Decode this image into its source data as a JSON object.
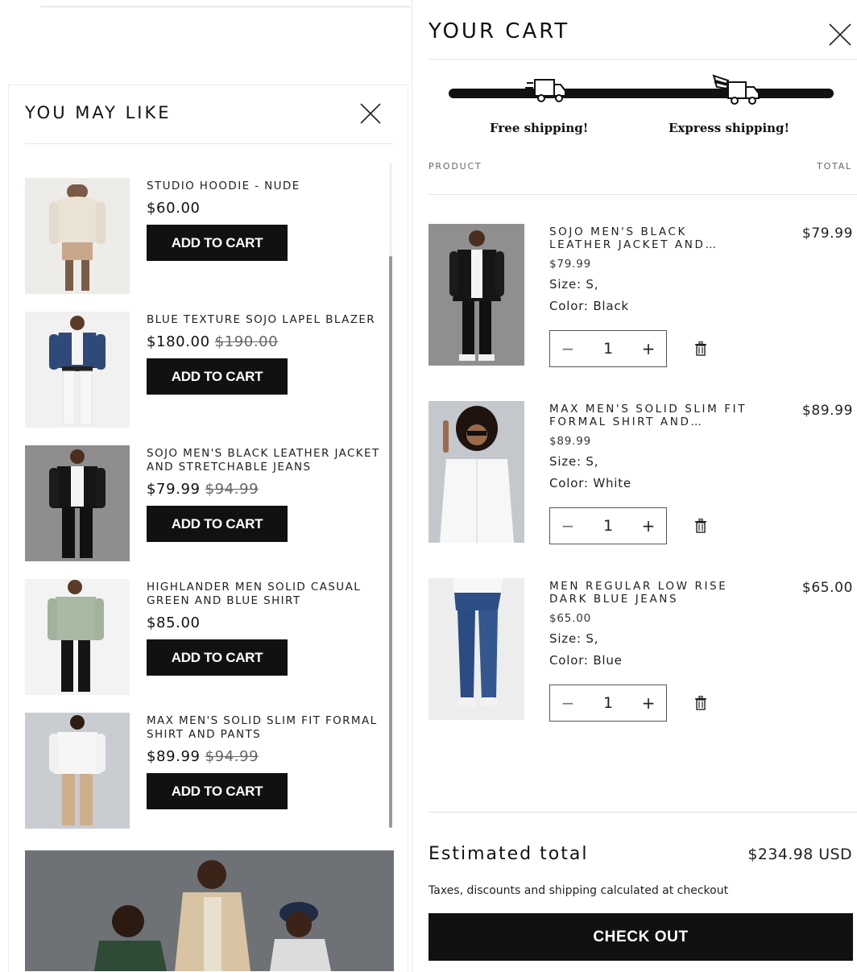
{
  "you_may_like": {
    "title": "YOU MAY LIKE",
    "close_icon": "close-icon",
    "items": [
      {
        "name": "STUDIO HOODIE - NUDE",
        "price": "$60.00",
        "compare_price": "",
        "button": "ADD TO CART",
        "image": "model-in-nude-hoodie"
      },
      {
        "name": "BLUE TEXTURE SOJO LAPEL BLAZER",
        "price": "$180.00",
        "compare_price": "$190.00",
        "button": "ADD TO CART",
        "image": "model-in-blue-blazer"
      },
      {
        "name": "SOJO MEN'S BLACK LEATHER JACKET AND STRETCHABLE JEANS",
        "price": "$79.99",
        "compare_price": "$94.99",
        "button": "ADD TO CART",
        "image": "model-in-leather-jacket"
      },
      {
        "name": "HIGHLANDER MEN SOLID CASUAL GREEN AND BLUE SHIRT",
        "price": "$85.00",
        "compare_price": "",
        "button": "ADD TO CART",
        "image": "model-in-green-shirt"
      },
      {
        "name": "MAX MEN'S SOLID SLIM FIT FORMAL SHIRT AND PANTS",
        "price": "$89.99",
        "compare_price": "$94.99",
        "button": "ADD TO CART",
        "image": "model-in-white-shirt"
      }
    ],
    "banner_image": "group-of-models-banner"
  },
  "cart": {
    "title": "YOUR CART",
    "close_icon": "close-icon",
    "shipping": {
      "milestones": [
        "Free shipping!",
        "Express shipping!"
      ],
      "progress": 1.0,
      "icons": [
        "delivery-truck-icon",
        "express-winged-truck-icon"
      ]
    },
    "columns": {
      "product": "PRODUCT",
      "total": "TOTAL"
    },
    "items": [
      {
        "name": "SOJO MEN'S BLACK LEATHER JACKET AND…",
        "unit_price": "$79.99",
        "size": "Size: S,",
        "color": "Color: Black",
        "quantity": "1",
        "total": "$79.99",
        "image": "model-in-leather-jacket"
      },
      {
        "name": "MAX MEN'S SOLID SLIM FIT FORMAL SHIRT AND…",
        "unit_price": "$89.99",
        "size": "Size: S,",
        "color": "Color: White",
        "quantity": "1",
        "total": "$89.99",
        "image": "model-with-sunglasses-white-shirt"
      },
      {
        "name": "MEN REGULAR LOW RISE DARK BLUE JEANS",
        "unit_price": "$65.00",
        "size": "Size: S,",
        "color": "Color: Blue",
        "quantity": "1",
        "total": "$65.00",
        "image": "model-in-blue-jeans"
      }
    ],
    "quantity_controls": {
      "minus": "−",
      "plus": "+"
    },
    "estimated_total_label": "Estimated total",
    "estimated_total_value": "$234.98 USD",
    "taxes_note": "Taxes, discounts and shipping calculated at checkout",
    "checkout_label": "CHECK OUT"
  },
  "colors": {
    "button_bg": "#111111",
    "button_text": "#ffffff",
    "divider": "#e6e6e6",
    "text": "#111111"
  }
}
